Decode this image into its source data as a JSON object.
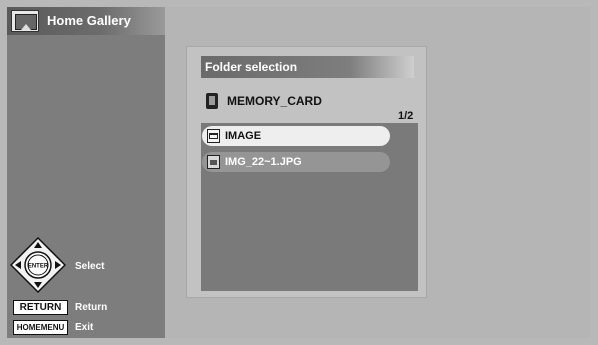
{
  "app": {
    "title": "Home Gallery",
    "icon": "gallery-icon"
  },
  "dialog": {
    "title": "Folder selection",
    "path_label": "MEMORY_CARD",
    "path_icon": "memory-card-icon",
    "page_indicator": "1/2",
    "items": [
      {
        "label": "IMAGE",
        "icon": "folder-icon",
        "selected": true
      },
      {
        "label": "IMG_22~1.JPG",
        "icon": "image-file-icon",
        "selected": false
      }
    ]
  },
  "legend": {
    "select_label": "Select",
    "enter_label": "ENTER",
    "return_key": "RETURN",
    "return_label": "Return",
    "homemenu_key": "HOMEMENU",
    "exit_label": "Exit"
  },
  "colors": {
    "background": "#b5b5b5",
    "sidebar": "#7d7d7d",
    "list_area": "#7a7a7a",
    "selected_item": "#eeeeee"
  }
}
